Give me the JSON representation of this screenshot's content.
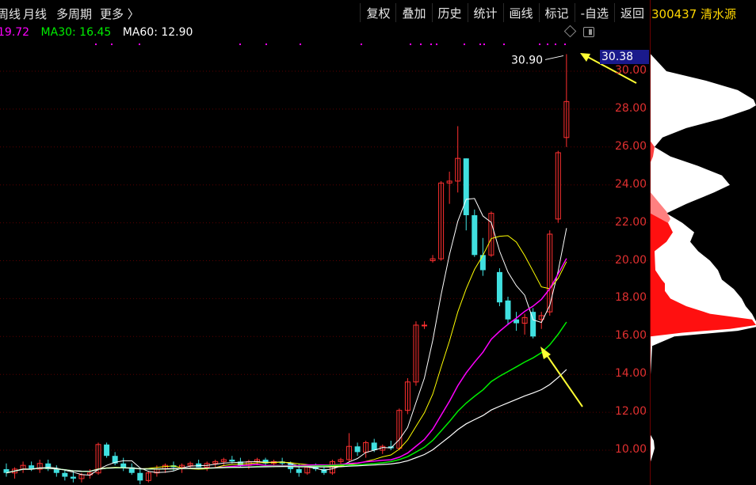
{
  "toolbar_left": [
    "周线",
    "月线",
    "多周期",
    "更多 〉"
  ],
  "toolbar_right": [
    "复权",
    "叠加",
    "历史",
    "统计",
    "画线",
    "标记",
    "-自选",
    "返回"
  ],
  "stock_code_name": "300437 清水源",
  "ma_values": {
    "ma20": "19.72",
    "ma30_label": "MA30: 16.45",
    "ma60_label": "MA60: 12.90"
  },
  "colors": {
    "ma20": "#ff00ff",
    "ma30": "#00ee00",
    "ma60": "#ffffff",
    "up": "#ff3030",
    "down": "#40e0e0",
    "axis": "#e03030",
    "annotation": "#ffff33"
  },
  "price_tag": "30.38",
  "high_label": "30.90",
  "chart_data": {
    "type": "candlestick",
    "y_axis_labels": [
      "30.00",
      "28.00",
      "26.00",
      "24.00",
      "22.00",
      "20.00",
      "18.00",
      "16.00",
      "14.00",
      "12.00",
      "10.00"
    ],
    "ylim": [
      8.5,
      31.2
    ],
    "high_marker": 30.9,
    "current_price": 30.38,
    "candles": [
      {
        "o": 9.0,
        "h": 9.3,
        "l": 8.6,
        "c": 8.8
      },
      {
        "o": 8.8,
        "h": 9.1,
        "l": 8.5,
        "c": 9.0
      },
      {
        "o": 9.0,
        "h": 9.4,
        "l": 8.8,
        "c": 9.2
      },
      {
        "o": 9.2,
        "h": 9.4,
        "l": 8.9,
        "c": 9.0
      },
      {
        "o": 9.0,
        "h": 9.5,
        "l": 8.8,
        "c": 9.3
      },
      {
        "o": 9.3,
        "h": 9.5,
        "l": 8.9,
        "c": 9.0
      },
      {
        "o": 9.0,
        "h": 9.2,
        "l": 8.6,
        "c": 8.8
      },
      {
        "o": 8.8,
        "h": 9.0,
        "l": 8.4,
        "c": 8.6
      },
      {
        "o": 8.6,
        "h": 8.9,
        "l": 8.3,
        "c": 8.5
      },
      {
        "o": 8.5,
        "h": 8.8,
        "l": 8.3,
        "c": 8.7
      },
      {
        "o": 8.7,
        "h": 9.0,
        "l": 8.5,
        "c": 8.8
      },
      {
        "o": 8.8,
        "h": 10.4,
        "l": 8.7,
        "c": 10.3
      },
      {
        "o": 10.3,
        "h": 10.4,
        "l": 9.6,
        "c": 9.7
      },
      {
        "o": 9.7,
        "h": 9.9,
        "l": 9.2,
        "c": 9.3
      },
      {
        "o": 9.3,
        "h": 9.6,
        "l": 8.9,
        "c": 9.1
      },
      {
        "o": 9.1,
        "h": 9.3,
        "l": 8.7,
        "c": 8.8
      },
      {
        "o": 8.8,
        "h": 9.0,
        "l": 8.2,
        "c": 8.4
      },
      {
        "o": 8.4,
        "h": 8.9,
        "l": 8.3,
        "c": 8.8
      },
      {
        "o": 8.8,
        "h": 9.2,
        "l": 8.6,
        "c": 9.0
      },
      {
        "o": 9.0,
        "h": 9.3,
        "l": 8.8,
        "c": 9.2
      },
      {
        "o": 9.2,
        "h": 9.4,
        "l": 8.9,
        "c": 9.1
      },
      {
        "o": 9.1,
        "h": 9.3,
        "l": 8.8,
        "c": 9.2
      },
      {
        "o": 9.2,
        "h": 9.4,
        "l": 9.0,
        "c": 9.3
      },
      {
        "o": 9.3,
        "h": 9.5,
        "l": 9.1,
        "c": 9.1
      },
      {
        "o": 9.1,
        "h": 9.4,
        "l": 8.9,
        "c": 9.3
      },
      {
        "o": 9.3,
        "h": 9.5,
        "l": 9.1,
        "c": 9.4
      },
      {
        "o": 9.4,
        "h": 9.6,
        "l": 9.2,
        "c": 9.5
      },
      {
        "o": 9.5,
        "h": 9.7,
        "l": 9.3,
        "c": 9.4
      },
      {
        "o": 9.4,
        "h": 9.6,
        "l": 9.1,
        "c": 9.2
      },
      {
        "o": 9.2,
        "h": 9.5,
        "l": 9.0,
        "c": 9.4
      },
      {
        "o": 9.4,
        "h": 9.6,
        "l": 9.2,
        "c": 9.5
      },
      {
        "o": 9.5,
        "h": 9.6,
        "l": 9.2,
        "c": 9.3
      },
      {
        "o": 9.3,
        "h": 9.5,
        "l": 9.1,
        "c": 9.4
      },
      {
        "o": 9.4,
        "h": 9.6,
        "l": 9.2,
        "c": 9.3
      },
      {
        "o": 9.3,
        "h": 9.4,
        "l": 8.8,
        "c": 9.0
      },
      {
        "o": 9.0,
        "h": 9.3,
        "l": 8.6,
        "c": 8.8
      },
      {
        "o": 8.8,
        "h": 9.2,
        "l": 8.7,
        "c": 9.1
      },
      {
        "o": 9.1,
        "h": 9.3,
        "l": 8.9,
        "c": 9.0
      },
      {
        "o": 9.0,
        "h": 9.2,
        "l": 8.7,
        "c": 8.8
      },
      {
        "o": 8.8,
        "h": 9.5,
        "l": 8.7,
        "c": 9.4
      },
      {
        "o": 9.4,
        "h": 9.6,
        "l": 9.2,
        "c": 9.5
      },
      {
        "o": 9.5,
        "h": 10.9,
        "l": 9.4,
        "c": 10.2
      },
      {
        "o": 10.2,
        "h": 10.4,
        "l": 9.7,
        "c": 9.9
      },
      {
        "o": 9.9,
        "h": 10.5,
        "l": 9.6,
        "c": 10.4
      },
      {
        "o": 10.4,
        "h": 10.6,
        "l": 9.9,
        "c": 10.0
      },
      {
        "o": 10.0,
        "h": 10.3,
        "l": 9.8,
        "c": 10.2
      },
      {
        "o": 10.2,
        "h": 10.5,
        "l": 10.0,
        "c": 10.1
      },
      {
        "o": 10.1,
        "h": 12.2,
        "l": 10.0,
        "c": 12.1
      },
      {
        "o": 12.1,
        "h": 13.8,
        "l": 11.9,
        "c": 13.6
      },
      {
        "o": 13.6,
        "h": 16.8,
        "l": 13.4,
        "c": 16.6
      },
      {
        "o": 16.6,
        "h": 16.8,
        "l": 16.4,
        "c": 16.6
      },
      {
        "o": 20.0,
        "h": 20.3,
        "l": 19.9,
        "c": 20.1
      },
      {
        "o": 20.1,
        "h": 24.2,
        "l": 20.0,
        "c": 24.1
      },
      {
        "o": 24.1,
        "h": 24.7,
        "l": 23.0,
        "c": 24.2
      },
      {
        "o": 24.2,
        "h": 27.1,
        "l": 23.6,
        "c": 25.4
      },
      {
        "o": 25.4,
        "h": 23.0,
        "l": 21.6,
        "c": 22.4
      },
      {
        "o": 22.4,
        "h": 22.7,
        "l": 20.2,
        "c": 20.3
      },
      {
        "o": 20.3,
        "h": 21.2,
        "l": 19.2,
        "c": 19.5
      },
      {
        "o": 20.3,
        "h": 22.6,
        "l": 20.2,
        "c": 22.5
      },
      {
        "o": 19.4,
        "h": 19.6,
        "l": 17.6,
        "c": 17.8
      },
      {
        "o": 17.9,
        "h": 18.1,
        "l": 16.6,
        "c": 16.9
      },
      {
        "o": 16.9,
        "h": 17.3,
        "l": 16.3,
        "c": 16.7
      },
      {
        "o": 16.7,
        "h": 17.2,
        "l": 16.1,
        "c": 17.0
      },
      {
        "o": 17.3,
        "h": 17.5,
        "l": 15.9,
        "c": 16.0
      },
      {
        "o": 16.9,
        "h": 17.3,
        "l": 16.4,
        "c": 17.1
      },
      {
        "o": 17.3,
        "h": 21.6,
        "l": 17.1,
        "c": 21.4
      },
      {
        "o": 22.2,
        "h": 25.8,
        "l": 22.0,
        "c": 25.7
      },
      {
        "o": 26.5,
        "h": 30.9,
        "l": 26.0,
        "c": 28.4
      }
    ]
  }
}
